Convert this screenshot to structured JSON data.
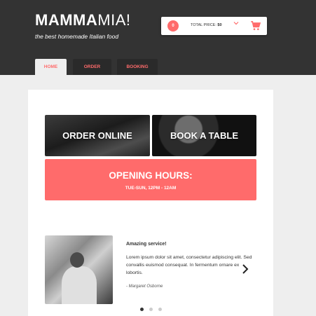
{
  "brand": {
    "logo_bold": "MAMMA",
    "logo_light": "MIA!",
    "tagline": "the best homemade Italian food"
  },
  "cart": {
    "count": "0",
    "total_label": "TOTAL PRICE:",
    "total_value": "$0",
    "chevron_icon": "chevron-down-icon",
    "cart_icon": "shopping-cart-icon"
  },
  "nav": {
    "tabs": [
      {
        "label": "HOME",
        "active": true
      },
      {
        "label": "ORDER",
        "active": false
      },
      {
        "label": "BOOKING",
        "active": false
      }
    ]
  },
  "tiles": {
    "order_label": "ORDER ONLINE",
    "booking_label": "BOOK A TABLE"
  },
  "hours": {
    "title": "OPENING HOURS:",
    "time": "TUE-SUN, 12PM - 12AM"
  },
  "review": {
    "title": "Amazing service!",
    "text": "Lorem ipsum dolor sit amet, consectetur adipiscing elit. Sed convallis euismod consequat. In fermentum ornare ex lobortis.",
    "author": "- Margaret Osborne",
    "next_icon": "chevron-right-icon"
  },
  "carousel": {
    "slide_count": 3,
    "active_index": 0
  },
  "colors": {
    "accent": "#ff6b6b",
    "header_bg": "#333333",
    "page_bg": "#eeeeee"
  }
}
